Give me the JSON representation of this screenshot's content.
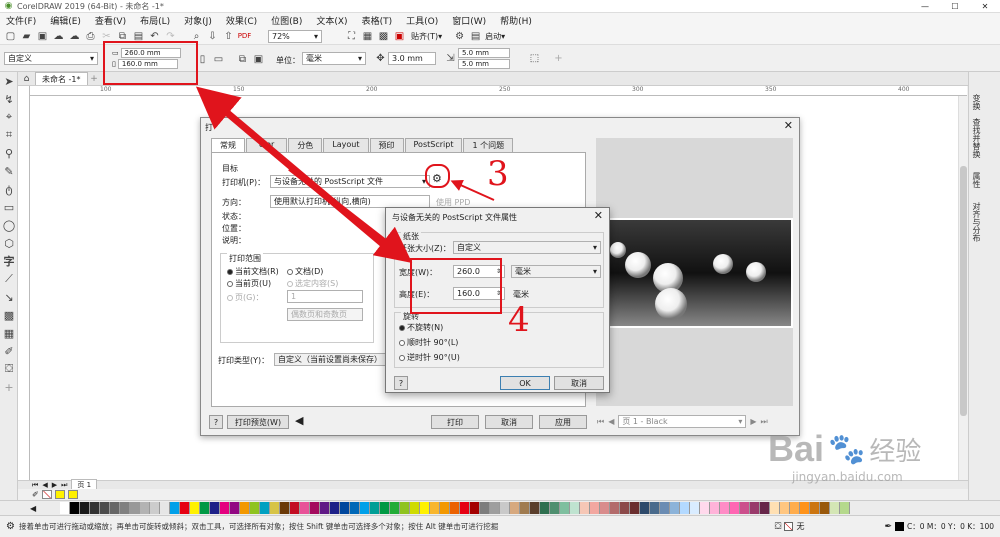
{
  "app": {
    "title": "CorelDRAW 2019 (64-Bit) - 未命名 -1*",
    "window_controls": [
      "—",
      "☐",
      "✕"
    ]
  },
  "menu": [
    "文件(F)",
    "编辑(E)",
    "查看(V)",
    "布局(L)",
    "对象(J)",
    "效果(C)",
    "位图(B)",
    "文本(X)",
    "表格(T)",
    "工具(O)",
    "窗口(W)",
    "帮助(H)"
  ],
  "toolbar1": {
    "zoom": "72%",
    "snap_label": "贴齐(T)",
    "launch_label": "启动"
  },
  "propbar": {
    "page_preset": "自定义",
    "width": "260.0 mm",
    "height": "160.0 mm",
    "unit_label": "单位：",
    "unit": "毫米",
    "nudge": "3.0 mm",
    "dup_x": "5.0 mm",
    "dup_y": "5.0 mm"
  },
  "doc_tab": "未命名 -1*",
  "ruler_ticks": [
    "100",
    "150",
    "200",
    "250",
    "300",
    "350",
    "400"
  ],
  "right_dock": [
    "变换",
    "查找并替换",
    "属性",
    "对齐与分布"
  ],
  "print_dialog": {
    "title": "打",
    "tabs": [
      "常规",
      "olor",
      "分色",
      "Layout",
      "预印",
      "PostScript",
      "1 个问题"
    ],
    "target_group": "目标",
    "printer_label": "打印机(P)：",
    "printer_value": "与设备无关的 PostScript 文件",
    "direction_label": "方向：",
    "direction_value": "使用默认打印机(纵向,横向)",
    "status_label": "状态：",
    "location_label": "位置：",
    "comment_label": "说明：",
    "use_ppd": "使用 PPD",
    "range_group": "打印范围",
    "range_current_doc": "当前文档(R)",
    "range_document": "文档(D)",
    "range_current_page": "当前页(U)",
    "range_selection": "选定内容(S)",
    "range_pages": "页(G)：",
    "pages_value": "1",
    "even_odd": "偶数页和奇数页",
    "print_type_label": "打印类型(Y)：",
    "print_type_value": "自定义（当前设置尚未保存）",
    "help_btn": "?",
    "preview_btn": "打印预览(W)",
    "print_btn": "打印",
    "cancel_btn": "取消",
    "apply_btn": "应用",
    "page_select": "页 1 - Black"
  },
  "ps_dialog": {
    "title": "与设备无关的 PostScript 文件属性",
    "paper_group": "纸张",
    "paper_size_label": "纸张大小(Z)：",
    "paper_size_value": "自定义",
    "width_label": "宽度(W)：",
    "width_value": "260.0",
    "height_label": "高度(E)：",
    "height_value": "160.0",
    "unit_value": "毫米",
    "unit_text": "毫米",
    "rotate_group": "旋转",
    "no_rotate": "不旋转(N)",
    "cw90": "顺时针 90°(L)",
    "ccw90": "逆时针 90°(U)",
    "help_btn": "?",
    "ok_btn": "OK",
    "cancel_btn": "取消"
  },
  "annotations": {
    "three": "3",
    "four": "4"
  },
  "page_tab": "页 1",
  "status": {
    "hint": "接着单击可进行拖动或缩放；再单击可旋转或倾斜；双击工具，可选择所有对象；按住 Shift 键单击可选择多个对象；按住 Alt 键单击可进行挖掘",
    "fill_none": "无",
    "color": "C：0 M：0 Y：0 K：100"
  },
  "watermark": {
    "brand": "Bai",
    "brand2": "经验",
    "url": "jingyan.baidu.com"
  },
  "palette": [
    "#ffffff",
    "#000000",
    "#1a1a1a",
    "#333333",
    "#4d4d4d",
    "#666666",
    "#808080",
    "#999999",
    "#b3b3b3",
    "#cccccc",
    "#e6e6e6",
    "#00a0e9",
    "#e60012",
    "#fff100",
    "#009944",
    "#1d2088",
    "#e4007f",
    "#920783",
    "#f39800",
    "#8fc31f",
    "#00a0c1",
    "#d7c447",
    "#6a3906",
    "#c30d23",
    "#e85298",
    "#a40b5d",
    "#601986",
    "#1d2088",
    "#00479d",
    "#0068b7",
    "#00a0e9",
    "#009e96",
    "#009944",
    "#22ac38",
    "#8fc31f",
    "#cfdb00",
    "#fff100",
    "#f8b62d",
    "#f39800",
    "#eb6100",
    "#e60012",
    "#a40000",
    "#7d7d7d",
    "#9e9e9e",
    "#c9c9c9",
    "#d7a97f",
    "#a07b4f",
    "#5a3e2b",
    "#2f6f4f",
    "#4f8f6f",
    "#7fbf9f",
    "#bfe3d0",
    "#f6c7b6",
    "#f2a7a0",
    "#d98c8c",
    "#b36b6b",
    "#8c4a4a",
    "#6b2e2e",
    "#2e4a6b",
    "#4a6b8c",
    "#6b8cb3",
    "#8cb3d9",
    "#b3d9ff",
    "#d9ecff",
    "#ffd9ec",
    "#ffb3d9",
    "#ff8cc6",
    "#ff66b3",
    "#cc4f8c",
    "#993a6b",
    "#662649",
    "#ffe0b3",
    "#ffc680",
    "#ffad4d",
    "#ff931a",
    "#cc7510",
    "#99580b",
    "#d4e6b5",
    "#b5d98c"
  ]
}
